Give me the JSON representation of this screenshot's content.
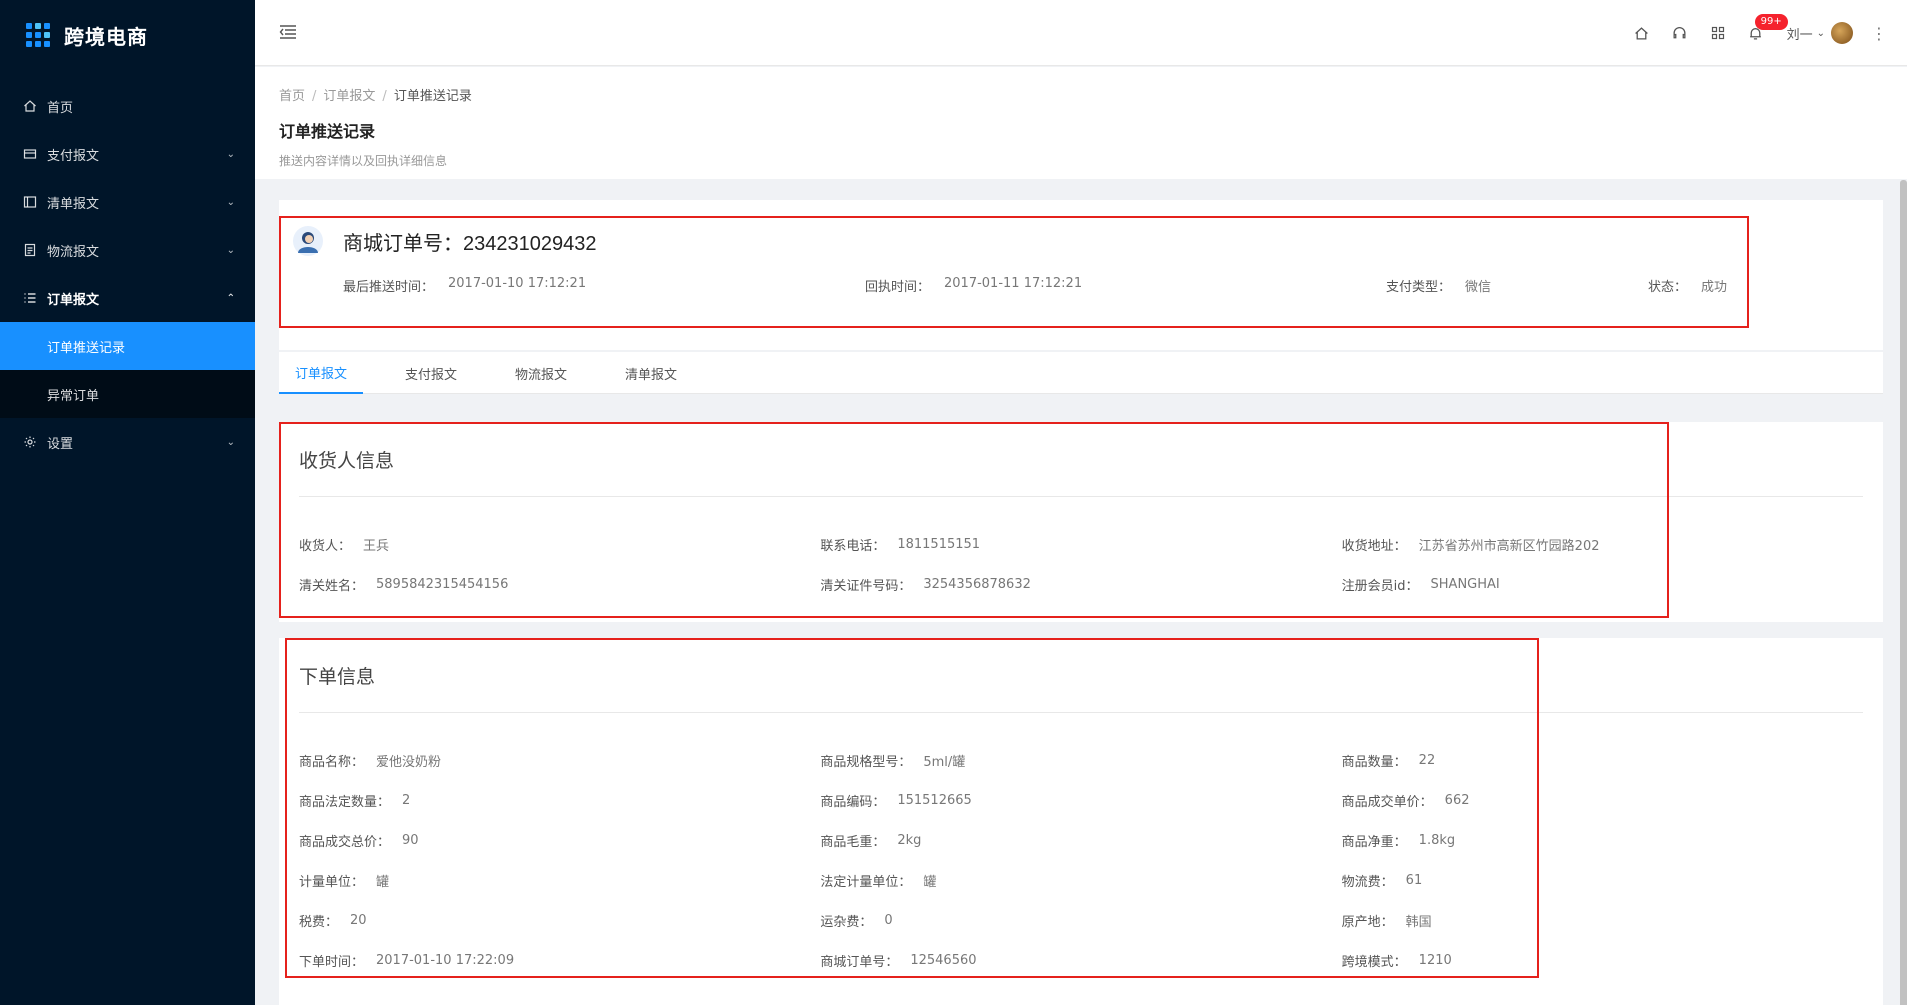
{
  "app": {
    "title": "跨境电商"
  },
  "sidebar": {
    "items": [
      {
        "label": "首页",
        "icon": "home-icon"
      },
      {
        "label": "支付报文",
        "icon": "credit-card-icon"
      },
      {
        "label": "清单报文",
        "icon": "list-icon"
      },
      {
        "label": "物流报文",
        "icon": "document-icon"
      },
      {
        "label": "订单报文",
        "icon": "order-list-icon"
      },
      {
        "label": "设置",
        "icon": "gear-icon"
      }
    ],
    "submenu": [
      {
        "label": "订单推送记录"
      },
      {
        "label": "异常订单"
      }
    ]
  },
  "header": {
    "badge": "99+",
    "user_name": "刘一"
  },
  "breadcrumb": [
    "首页",
    "订单报文",
    "订单推送记录"
  ],
  "page": {
    "title": "订单推送记录",
    "desc": "推送内容详情以及回执详细信息"
  },
  "order": {
    "no_label": "商城订单号：",
    "no_value": "234231029432",
    "meta": [
      {
        "label": "最后推送时间：",
        "value": "2017-01-10 17:12:21"
      },
      {
        "label": "回执时间：",
        "value": "2017-01-11 17:12:21"
      },
      {
        "label": "支付类型：",
        "value": "微信"
      },
      {
        "label": "状态：",
        "value": "成功"
      }
    ]
  },
  "tabs": [
    "订单报文",
    "支付报文",
    "物流报文",
    "清单报文"
  ],
  "receiver": {
    "title": "收货人信息",
    "fields": [
      {
        "label": "收货人：",
        "value": "王兵"
      },
      {
        "label": "联系电话：",
        "value": "1811515151"
      },
      {
        "label": "收货地址：",
        "value": "江苏省苏州市高新区竹园路202"
      },
      {
        "label": "清关姓名：",
        "value": "5895842315454156"
      },
      {
        "label": "清关证件号码：",
        "value": "3254356878632"
      },
      {
        "label": "注册会员id：",
        "value": "SHANGHAI"
      }
    ]
  },
  "order_info": {
    "title": "下单信息",
    "fields": [
      {
        "label": "商品名称：",
        "value": "爱他没奶粉"
      },
      {
        "label": "商品规格型号：",
        "value": "5ml/罐"
      },
      {
        "label": "商品数量：",
        "value": "22"
      },
      {
        "label": "商品法定数量：",
        "value": "2"
      },
      {
        "label": "商品编码：",
        "value": "151512665"
      },
      {
        "label": "商品成交单价：",
        "value": "662"
      },
      {
        "label": "商品成交总价：",
        "value": "90"
      },
      {
        "label": "商品毛重：",
        "value": "2kg"
      },
      {
        "label": "商品净重：",
        "value": "1.8kg"
      },
      {
        "label": "计量单位：",
        "value": "罐"
      },
      {
        "label": "法定计量单位：",
        "value": "罐"
      },
      {
        "label": "物流费：",
        "value": "61"
      },
      {
        "label": "税费：",
        "value": "20"
      },
      {
        "label": "运杂费：",
        "value": "0"
      },
      {
        "label": "原产地：",
        "value": "韩国"
      },
      {
        "label": "下单时间：",
        "value": "2017-01-10 17:22:09"
      },
      {
        "label": "商城订单号：",
        "value": "12546560"
      },
      {
        "label": "跨境模式：",
        "value": "1210"
      }
    ]
  },
  "colors": {
    "accent": "#1890ff",
    "sidebar_bg": "#001529",
    "highlight": "#e5211c"
  }
}
